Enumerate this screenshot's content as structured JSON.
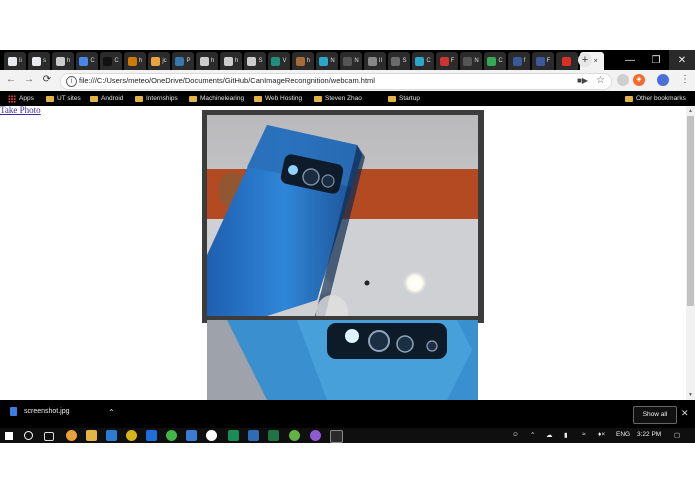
{
  "browser": {
    "tabs": [
      {
        "label": "li",
        "icon": "google-icon",
        "color": "#e8eaed"
      },
      {
        "label": "s",
        "icon": "google-icon",
        "color": "#e8eaed"
      },
      {
        "label": "h",
        "icon": "github-icon",
        "color": "#cccccc"
      },
      {
        "label": "C",
        "icon": "calendar-icon",
        "color": "#4a86e8"
      },
      {
        "label": "C",
        "icon": "m-icon",
        "color": "#111111"
      },
      {
        "label": "h",
        "icon": "h-icon",
        "color": "#cc7a00"
      },
      {
        "label": "jc",
        "icon": "j-icon",
        "color": "#e8a33d"
      },
      {
        "label": "P",
        "icon": "python-icon",
        "color": "#3776ab"
      },
      {
        "label": "h",
        "icon": "github-icon",
        "color": "#cccccc"
      },
      {
        "label": "h",
        "icon": "github-icon",
        "color": "#cccccc"
      },
      {
        "label": "S",
        "icon": "github-icon",
        "color": "#cccccc"
      },
      {
        "label": "V",
        "icon": "terminal-icon",
        "color": "#1f8f7a"
      },
      {
        "label": "h",
        "icon": "h-icon",
        "color": "#a56a3a"
      },
      {
        "label": "N",
        "icon": "cloud-icon",
        "color": "#2aa7c9"
      },
      {
        "label": "N",
        "icon": "monitor-icon",
        "color": "#555555"
      },
      {
        "label": "II",
        "icon": "stack-icon",
        "color": "#888888"
      },
      {
        "label": "S",
        "icon": "s-icon",
        "color": "#6a6a6a"
      },
      {
        "label": "C",
        "icon": "c-icon",
        "color": "#2aa7c9"
      },
      {
        "label": "F",
        "icon": "f-icon",
        "color": "#c33"
      },
      {
        "label": "N",
        "icon": "n-icon",
        "color": "#555555"
      },
      {
        "label": "C",
        "icon": "drive-icon",
        "color": "#34a853"
      },
      {
        "label": "f",
        "icon": "facebook-icon",
        "color": "#3b5998"
      },
      {
        "label": "F",
        "icon": "f-icon",
        "color": "#3b5998"
      },
      {
        "label": "",
        "icon": "record-icon",
        "color": "#d93025"
      }
    ],
    "active_tab": {
      "label": "D",
      "close": "×"
    },
    "new_tab": "+",
    "window_controls": {
      "minimize": "—",
      "restore": "❐",
      "close": "✕"
    },
    "url": "file:///C:/Users/meteo/OneDrive/Documents/GitHub/CanImageRecongnition/webcam.html",
    "bookmarks": [
      "Apps",
      "UT sites",
      "Android",
      "Internships",
      "Machinelearing",
      "Web Hosting",
      "Steven Zhao",
      "Startup"
    ],
    "other_bookmarks": "Other bookmarks"
  },
  "page": {
    "link_text": "Take Photo"
  },
  "downloads": {
    "filename": "screenshot.jpg",
    "show_all": "Show all",
    "close": "✕"
  },
  "taskbar": {
    "language": "ENG",
    "time": "3:22 PM"
  }
}
